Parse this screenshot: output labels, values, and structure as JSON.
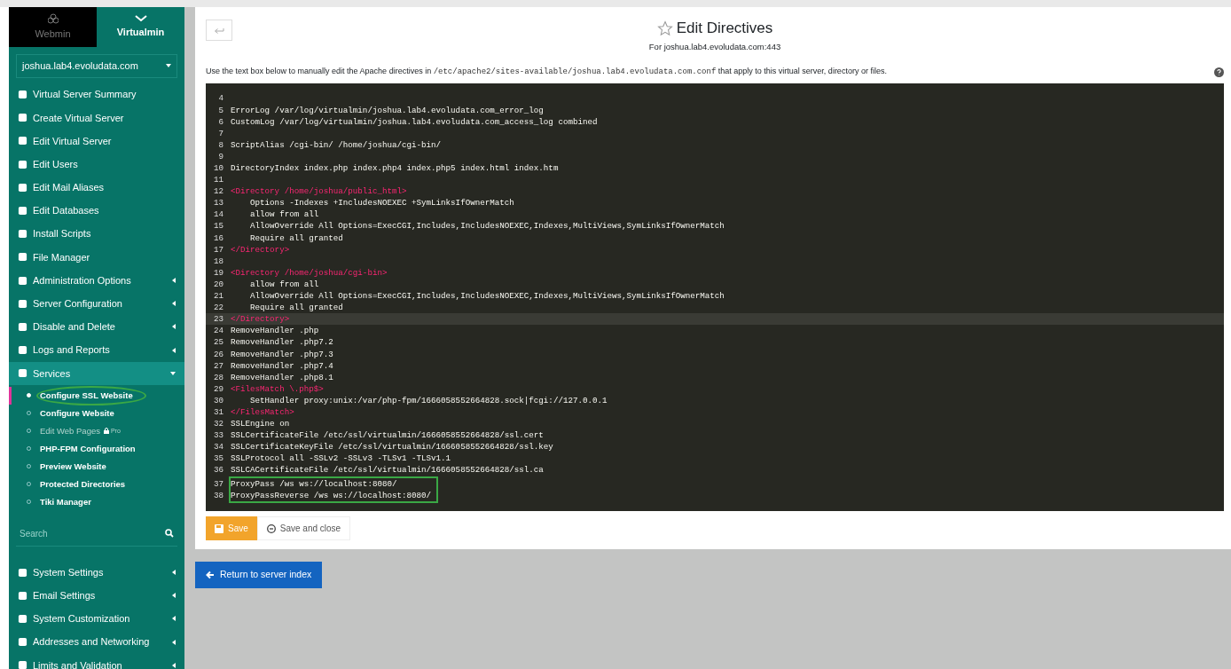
{
  "sidebar": {
    "switcher": [
      {
        "label": "Webmin",
        "selected": false
      },
      {
        "label": "Virtualmin",
        "selected": true
      }
    ],
    "domain": "joshua.lab4.evoludata.com",
    "items": [
      {
        "label": "Virtual Server Summary",
        "expandable": false
      },
      {
        "label": "Create Virtual Server",
        "expandable": false
      },
      {
        "label": "Edit Virtual Server",
        "expandable": false
      },
      {
        "label": "Edit Users",
        "expandable": false
      },
      {
        "label": "Edit Mail Aliases",
        "expandable": false
      },
      {
        "label": "Edit Databases",
        "expandable": false
      },
      {
        "label": "Install Scripts",
        "expandable": false
      },
      {
        "label": "File Manager",
        "expandable": false
      },
      {
        "label": "Administration Options",
        "expandable": true,
        "expanded": false
      },
      {
        "label": "Server Configuration",
        "expandable": true,
        "expanded": false
      },
      {
        "label": "Disable and Delete",
        "expandable": true,
        "expanded": false
      },
      {
        "label": "Logs and Reports",
        "expandable": true,
        "expanded": false
      },
      {
        "label": "Services",
        "expandable": true,
        "expanded": true,
        "children": [
          {
            "label": "Configure SSL Website",
            "selected": true,
            "disabled": false,
            "highlighted": true
          },
          {
            "label": "Configure Website",
            "selected": false,
            "disabled": false,
            "highlighted": false
          },
          {
            "label": "Edit Web Pages",
            "selected": false,
            "disabled": true,
            "highlighted": false,
            "badge": "Pro"
          },
          {
            "label": "PHP-FPM Configuration",
            "selected": false,
            "disabled": false,
            "highlighted": false
          },
          {
            "label": "Preview Website",
            "selected": false,
            "disabled": false,
            "highlighted": false
          },
          {
            "label": "Protected Directories",
            "selected": false,
            "disabled": false,
            "highlighted": false
          },
          {
            "label": "Tiki Manager",
            "selected": false,
            "disabled": false,
            "highlighted": false
          }
        ]
      }
    ],
    "search": {
      "placeholder": "Search"
    },
    "items_bottom": [
      {
        "label": "System Settings",
        "expandable": true,
        "expanded": false
      },
      {
        "label": "Email Settings",
        "expandable": true,
        "expanded": false
      },
      {
        "label": "System Customization",
        "expandable": true,
        "expanded": false
      },
      {
        "label": "Addresses and Networking",
        "expandable": true,
        "expanded": false
      },
      {
        "label": "Limits and Validation",
        "expandable": true,
        "expanded": false
      }
    ]
  },
  "header": {
    "title": "Edit Directives",
    "subtitle": "For joshua.lab4.evoludata.com:443"
  },
  "intro": {
    "before": "Use the text box below to manually edit the Apache directives in",
    "path": "/etc/apache2/sites-available/joshua.lab4.evoludata.com.conf",
    "after": "that apply to this virtual server, directory or files."
  },
  "editor": {
    "lines": [
      {
        "number": "4",
        "current": false,
        "highlighted": false
      },
      {
        "number": "5",
        "text": "ErrorLog /var/log/virtualmin/joshua.lab4.evoludata.com_error_log",
        "kind": "text",
        "current": false,
        "highlighted": false
      },
      {
        "number": "6",
        "text": "CustomLog /var/log/virtualmin/joshua.lab4.evoludata.com_access_log combined",
        "kind": "text",
        "current": false,
        "highlighted": false
      },
      {
        "number": "7",
        "current": false,
        "highlighted": false
      },
      {
        "number": "8",
        "text": "ScriptAlias /cgi-bin/ /home/joshua/cgi-bin/",
        "kind": "text",
        "current": false,
        "highlighted": false
      },
      {
        "number": "9",
        "current": false,
        "highlighted": false
      },
      {
        "number": "10",
        "text": "DirectoryIndex index.php index.php4 index.php5 index.html index.htm",
        "kind": "text",
        "current": false,
        "highlighted": false
      },
      {
        "number": "11",
        "current": false,
        "highlighted": false
      },
      {
        "number": "12",
        "text": "<Directory /home/joshua/public_html>",
        "kind": "tag",
        "current": false,
        "highlighted": false
      },
      {
        "number": "13",
        "text": "    Options -Indexes +IncludesNOEXEC +SymLinksIfOwnerMatch",
        "kind": "text",
        "current": false,
        "highlighted": false
      },
      {
        "number": "14",
        "text": "    allow from all",
        "kind": "text",
        "current": false,
        "highlighted": false
      },
      {
        "number": "15",
        "text": "    AllowOverride All Options=ExecCGI,Includes,IncludesNOEXEC,Indexes,MultiViews,SymLinksIfOwnerMatch",
        "kind": "text",
        "current": false,
        "highlighted": false
      },
      {
        "number": "16",
        "text": "    Require all granted",
        "kind": "text",
        "current": false,
        "highlighted": false
      },
      {
        "number": "17",
        "text": "</Directory>",
        "kind": "tag",
        "current": false,
        "highlighted": false
      },
      {
        "number": "18",
        "current": false,
        "highlighted": false
      },
      {
        "number": "19",
        "text": "<Directory /home/joshua/cgi-bin>",
        "kind": "tag",
        "current": false,
        "highlighted": false
      },
      {
        "number": "20",
        "text": "    allow from all",
        "kind": "text",
        "current": false,
        "highlighted": false
      },
      {
        "number": "21",
        "text": "    AllowOverride All Options=ExecCGI,Includes,IncludesNOEXEC,Indexes,MultiViews,SymLinksIfOwnerMatch",
        "kind": "text",
        "current": false,
        "highlighted": false
      },
      {
        "number": "22",
        "text": "    Require all granted",
        "kind": "text",
        "current": false,
        "highlighted": false
      },
      {
        "number": "23",
        "text": "</Directory>",
        "kind": "tag",
        "current": true,
        "highlighted": false
      },
      {
        "number": "24",
        "text": "RemoveHandler .php",
        "kind": "text",
        "current": false,
        "highlighted": false
      },
      {
        "number": "25",
        "text": "RemoveHandler .php7.2",
        "kind": "text",
        "current": false,
        "highlighted": false
      },
      {
        "number": "26",
        "text": "RemoveHandler .php7.3",
        "kind": "text",
        "current": false,
        "highlighted": false
      },
      {
        "number": "27",
        "text": "RemoveHandler .php7.4",
        "kind": "text",
        "current": false,
        "highlighted": false
      },
      {
        "number": "28",
        "text": "RemoveHandler .php8.1",
        "kind": "text",
        "current": false,
        "highlighted": false
      },
      {
        "number": "29",
        "text": "<FilesMatch \\.php$>",
        "kind": "tag",
        "current": false,
        "highlighted": false
      },
      {
        "number": "30",
        "text": "    SetHandler proxy:unix:/var/php-fpm/1666058552664828.sock|fcgi://127.0.0.1",
        "kind": "text",
        "current": false,
        "highlighted": false
      },
      {
        "number": "31",
        "text": "</FilesMatch>",
        "kind": "tag",
        "current": false,
        "highlighted": false
      },
      {
        "number": "32",
        "text": "SSLEngine on",
        "kind": "text",
        "current": false,
        "highlighted": false
      },
      {
        "number": "33",
        "text": "SSLCertificateFile /etc/ssl/virtualmin/1666058552664828/ssl.cert",
        "kind": "text",
        "current": false,
        "highlighted": false
      },
      {
        "number": "34",
        "text": "SSLCertificateKeyFile /etc/ssl/virtualmin/1666058552664828/ssl.key",
        "kind": "text",
        "current": false,
        "highlighted": false
      },
      {
        "number": "35",
        "text": "SSLProtocol all -SSLv2 -SSLv3 -TLSv1 -TLSv1.1",
        "kind": "text",
        "current": false,
        "highlighted": false
      },
      {
        "number": "36",
        "text": "SSLCACertificateFile /etc/ssl/virtualmin/1666058552664828/ssl.ca",
        "kind": "text",
        "current": false,
        "highlighted": false
      },
      {
        "number": "37",
        "text": "ProxyPass /ws ws://localhost:8080/",
        "kind": "text",
        "current": false,
        "highlighted": true
      },
      {
        "number": "38",
        "text": "ProxyPassReverse /ws ws://localhost:8080/",
        "kind": "text",
        "current": false,
        "highlighted": true
      }
    ]
  },
  "buttons": {
    "save": "Save",
    "save_close": "Save and close",
    "return": "Return to server index"
  }
}
